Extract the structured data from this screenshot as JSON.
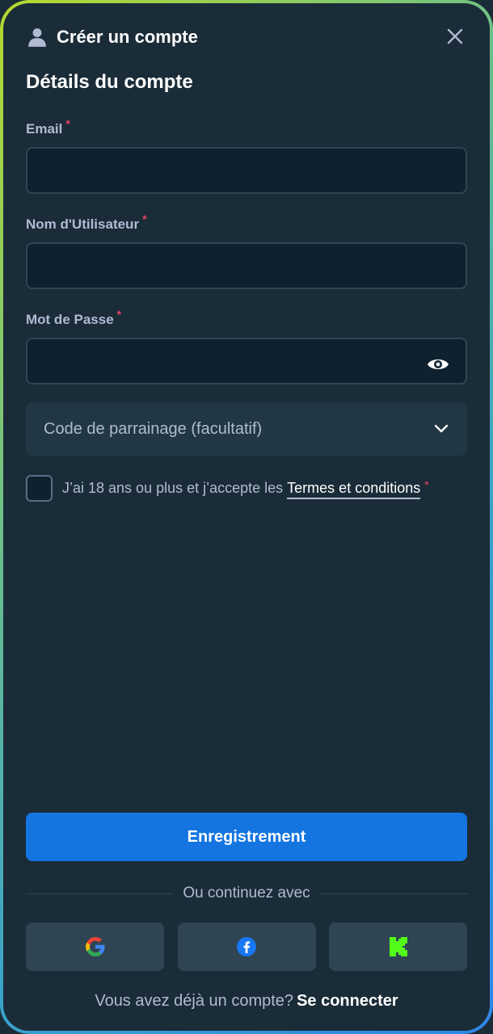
{
  "header": {
    "title": "Créer un compte",
    "user_icon": "user-icon",
    "close_icon": "close-icon"
  },
  "form": {
    "section_title": "Détails du compte",
    "required_marker": "*",
    "email": {
      "label": "Email",
      "value": "",
      "placeholder": ""
    },
    "username": {
      "label": "Nom d'Utilisateur",
      "value": "",
      "placeholder": ""
    },
    "password": {
      "label": "Mot de Passe",
      "value": "",
      "placeholder": "",
      "toggle_icon": "eye-icon"
    },
    "referral": {
      "label": "Code de parrainage (facultatif)",
      "icon": "chevron-down-icon"
    },
    "terms": {
      "text": "J’ai 18 ans ou plus et j’accepte les",
      "link": "Termes et conditions",
      "checked": false
    }
  },
  "actions": {
    "register_label": "Enregistrement",
    "divider_text": "Ou continuez avec",
    "social": [
      {
        "name": "google",
        "icon": "google-icon"
      },
      {
        "name": "facebook",
        "icon": "facebook-icon"
      },
      {
        "name": "kick",
        "icon": "kick-icon"
      }
    ]
  },
  "footer": {
    "prompt": "Vous avez déjà un compte?",
    "login_label": "Se connecter"
  },
  "colors": {
    "background": "#1a2c38",
    "input_bg": "#0f212e",
    "primary": "#1475e1",
    "required": "#ed4163",
    "muted_text": "#b1bad3"
  }
}
